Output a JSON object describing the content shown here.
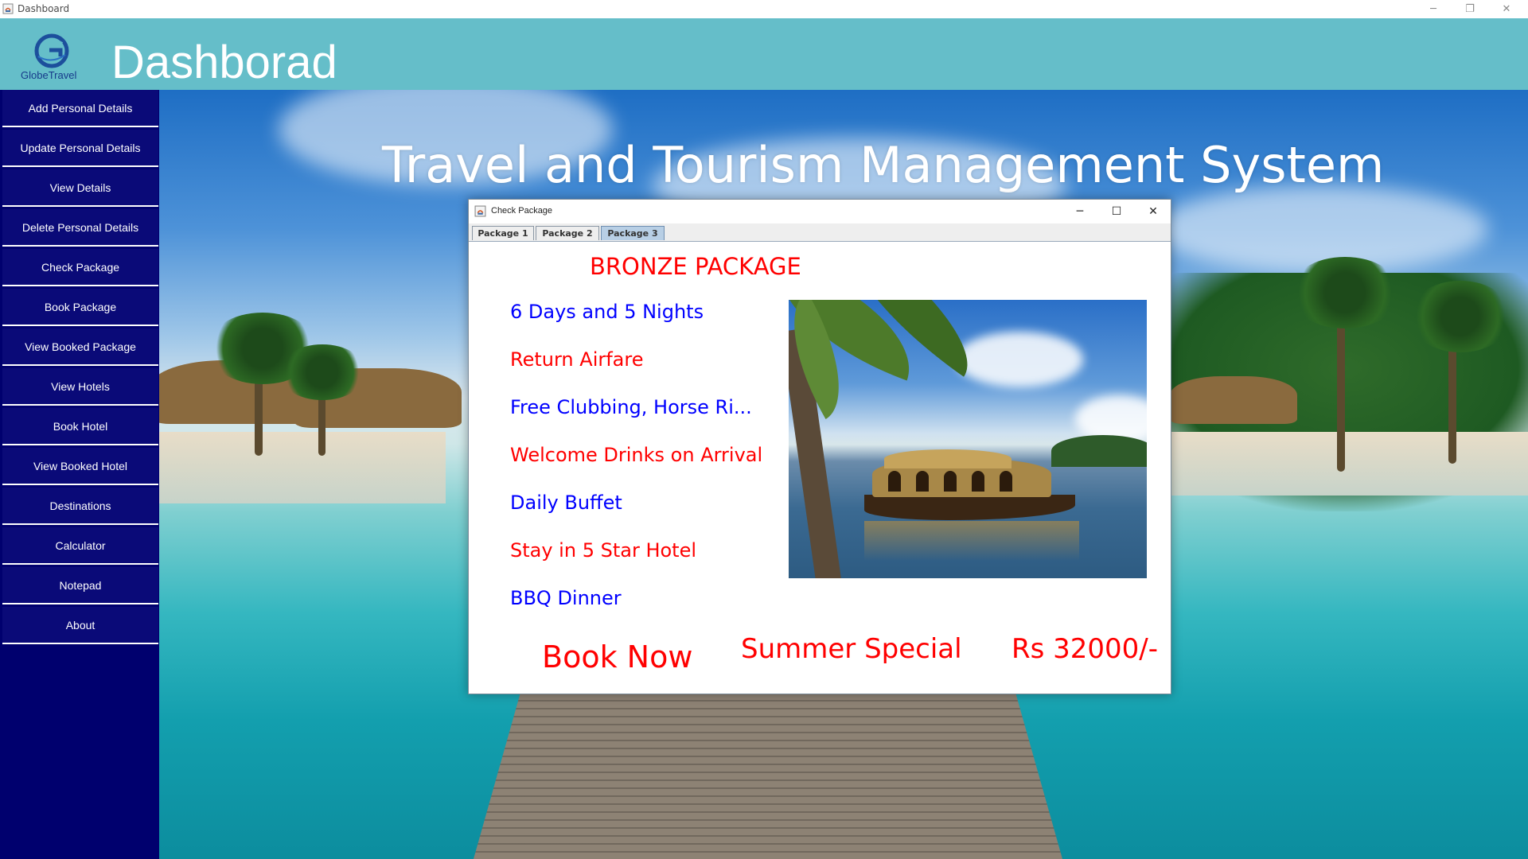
{
  "window": {
    "title": "Dashboard",
    "controls": [
      "─",
      "❐",
      "✕"
    ]
  },
  "header": {
    "logo_brand": "GlobeTravel",
    "title": "Dashborad"
  },
  "sidebar": {
    "items": [
      {
        "label": "Add Personal Details"
      },
      {
        "label": "Update Personal Details"
      },
      {
        "label": "View Details"
      },
      {
        "label": "Delete Personal Details"
      },
      {
        "label": "Check Package"
      },
      {
        "label": "Book Package"
      },
      {
        "label": "View Booked Package"
      },
      {
        "label": "View Hotels"
      },
      {
        "label": "Book Hotel"
      },
      {
        "label": "View Booked Hotel"
      },
      {
        "label": "Destinations"
      },
      {
        "label": "Calculator"
      },
      {
        "label": "Notepad"
      },
      {
        "label": "About"
      }
    ]
  },
  "main": {
    "hero_title": "Travel and Tourism Management System"
  },
  "dialog": {
    "title": "Check Package",
    "controls": [
      "─",
      "☐",
      "✕"
    ],
    "tabs": [
      {
        "label": "Package 1",
        "active": false
      },
      {
        "label": "Package 2",
        "active": false
      },
      {
        "label": "Package 3",
        "active": true
      }
    ],
    "package": {
      "title": "BRONZE PACKAGE",
      "features": [
        {
          "text": "6 Days and 5 Nights",
          "color": "blue"
        },
        {
          "text": "Return Airfare",
          "color": "red"
        },
        {
          "text": "Free Clubbing, Horse Ri...",
          "color": "blue"
        },
        {
          "text": "Welcome Drinks on Arrival",
          "color": "red"
        },
        {
          "text": "Daily Buffet",
          "color": "blue"
        },
        {
          "text": "Stay in 5 Star Hotel",
          "color": "red"
        },
        {
          "text": "BBQ Dinner",
          "color": "blue"
        }
      ],
      "book_button": "Book Now",
      "offer": "Summer Special",
      "price": "Rs 32000/-"
    }
  },
  "colors": {
    "header_bg": "#65bec9",
    "sidebar_bg": "#00006e",
    "feature_blue": "#0000ff",
    "feature_red": "#ff0000"
  }
}
